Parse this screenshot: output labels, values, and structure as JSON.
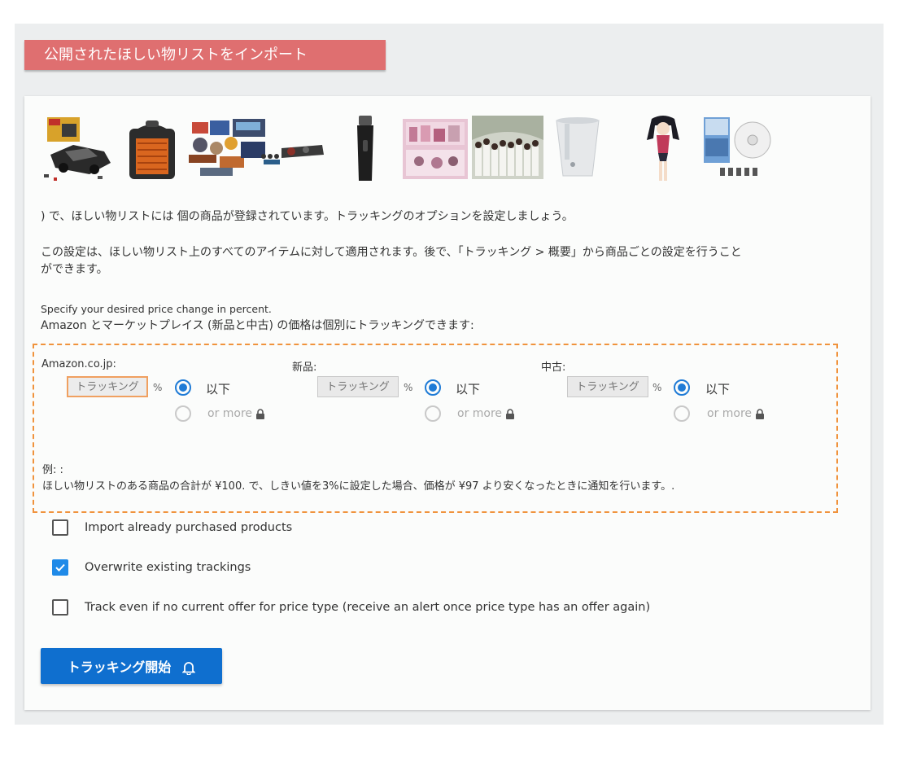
{
  "header": {
    "title": "公開されたほしい物リストをインポート"
  },
  "products": [
    {
      "icon": "lego-car-set-image"
    },
    {
      "icon": "portable-heater-image"
    },
    {
      "icon": "figure-collection-image"
    },
    {
      "icon": "electric-shaver-image"
    },
    {
      "icon": "toy-dollhouse-image"
    },
    {
      "icon": "idol-group-photo-image"
    },
    {
      "icon": "humidifier-image"
    },
    {
      "icon": "anime-figure-image"
    },
    {
      "icon": "dvd-boxset-image"
    }
  ],
  "intro": {
    "line1": ") で、ほしい物リストには 個の商品が登録されています。トラッキングのオプションを設定しましょう。",
    "line2a": "この設定は、ほしい物リスト上のすべてのアイテムに対して適用されます。後で、「トラッキング > 概要」から商品ごとの設定を行うこと",
    "line2b": "ができます。",
    "specify": "Specify your desired price change in percent.",
    "separate": "Amazon とマーケットプレイス (新品と中古) の価格は個別にトラッキングできます:"
  },
  "columns": [
    {
      "label": "Amazon.co.jp:",
      "placeholder": "トラッキング",
      "percent": "%",
      "below": "以下",
      "above": "or more"
    },
    {
      "label": "新品:",
      "placeholder": "トラッキング",
      "percent": "%",
      "below": "以下",
      "above": "or more"
    },
    {
      "label": "中古:",
      "placeholder": "トラッキング",
      "percent": "%",
      "below": "以下",
      "above": "or more"
    }
  ],
  "example": {
    "title": "例: :",
    "text": "ほしい物リストのある商品の合計が ¥100. で、しきい値を3%に設定した場合、価格が ¥97 より安くなったときに通知を行います。."
  },
  "options": [
    {
      "label": "Import already purchased products",
      "checked": false
    },
    {
      "label": "Overwrite existing trackings",
      "checked": true
    },
    {
      "label": "Track even if no current offer for price type (receive an alert once price type has an offer again)",
      "checked": false
    }
  ],
  "start_button": {
    "label": "トラッキング開始"
  }
}
